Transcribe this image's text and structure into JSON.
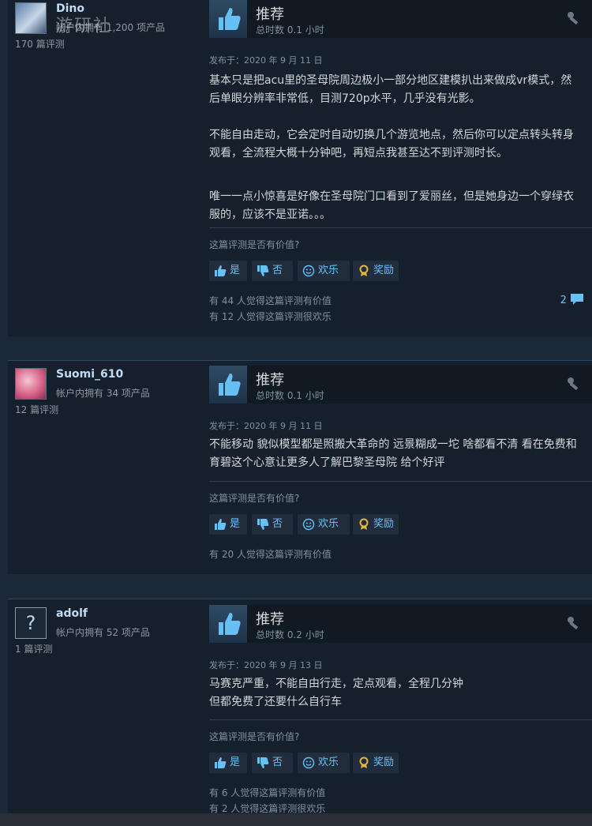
{
  "reviews": [
    {
      "player": {
        "name": "Dino",
        "owned": "帐户内拥有 1,200 项产品",
        "reviews": "170 篇评测"
      },
      "vote": {
        "title": "推荐",
        "hours": "总时数 0.1 小时"
      },
      "posted": "发布于：2020 年 9 月 11 日",
      "paragraphs": [
        "基本只是把acu里的圣母院周边极小一部分地区建模扒出来做成vr模式，然后单眼分辨率非常低，目测720p水平，几乎没有光影。",
        "不能自由走动，它会定时自动切换几个游览地点，然后你可以定点转头转身观看，全流程大概十分钟吧，再短点我甚至达不到评测时长。",
        "唯一一点小惊喜是好像在圣母院门口看到了爱丽丝，但是她身边一个穿绿衣服的，应该不是亚诺。。。"
      ],
      "helpful_q": "这篇评测是否有价值?",
      "buttons": {
        "yes": "是",
        "no": "否",
        "funny": "欢乐",
        "award": "奖励"
      },
      "summary": [
        "有 44 人觉得这篇评测有价值",
        "有 12 人觉得这篇评测很欢乐"
      ],
      "comments": "2"
    },
    {
      "player": {
        "name": "Suomi_610",
        "owned": "帐户内拥有 34 项产品",
        "reviews": "12 篇评测"
      },
      "vote": {
        "title": "推荐",
        "hours": "总时数 0.1 小时"
      },
      "posted": "发布于：2020 年 9 月 11 日",
      "paragraphs": [
        "不能移动 貌似模型都是照搬大革命的 远景糊成一坨 啥都看不清 看在免费和育碧这个心意让更多人了解巴黎圣母院 给个好评"
      ],
      "helpful_q": "这篇评测是否有价值?",
      "buttons": {
        "yes": "是",
        "no": "否",
        "funny": "欢乐",
        "award": "奖励"
      },
      "summary": [
        "有 20 人觉得这篇评测有价值"
      ]
    },
    {
      "player": {
        "name": "adolf",
        "avatar_glyph": "?",
        "owned": "帐户内拥有 52 项产品",
        "reviews": "1 篇评测"
      },
      "vote": {
        "title": "推荐",
        "hours": "总时数 0.2 小时"
      },
      "posted": "发布于：2020 年 9 月 13 日",
      "paragraphs": [
        "马赛克严重，不能自由行走，定点观看，全程几分钟",
        "但都免费了还要什么自行车"
      ],
      "helpful_q": "这篇评测是否有价值?",
      "buttons": {
        "yes": "是",
        "no": "否",
        "funny": "欢乐",
        "award": "奖励"
      },
      "summary": [
        "有 6 人觉得这篇评测有价值",
        "有 2 人觉得这篇评测很欢乐"
      ]
    }
  ],
  "watermark": "游研社",
  "colors": {
    "link": "#67c1f5",
    "panel": "#16202d",
    "page": "#1b2838"
  }
}
